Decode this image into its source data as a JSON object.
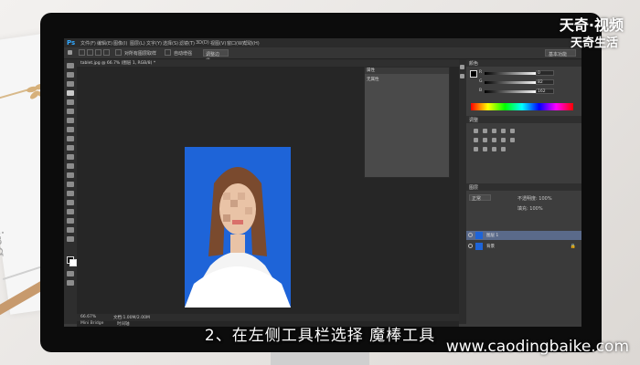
{
  "watermark": {
    "line1": "天奇·视频",
    "line2": "天奇生活"
  },
  "website": "www.caodingbaike.com",
  "subtitle": "2、在左侧工具栏选择 魔棒工具",
  "background_paper_text": "text blurring\nbe blurring\nproduce",
  "photoshop": {
    "logo": "Ps",
    "menu": [
      "文件(F)",
      "编辑(E)",
      "图像(I)",
      "图层(L)",
      "文字(Y)",
      "选择(S)",
      "滤镜(T)",
      "3D(D)",
      "视图(V)",
      "窗口(W)",
      "帮助(H)"
    ],
    "options_bar": {
      "contiguous_label": "对所有图层取样",
      "auto_enhance_label": "自动增强",
      "refine_edge_label": "调整边缘...",
      "workspace": "基本功能"
    },
    "document_tab": "tablet.jpg @ 66.7% (图层 1, RGB/8) *",
    "status": {
      "zoom": "66.67%",
      "doc": "文档:1.00M/2.00M"
    },
    "bottom_tabs": [
      "Mini Bridge",
      "时间轴"
    ],
    "float_panel": {
      "title": "属性",
      "body": "无属性"
    },
    "color_panel": {
      "title": "颜色",
      "channels": [
        "R",
        "G",
        "B"
      ],
      "values": [
        "0",
        "82",
        "162"
      ]
    },
    "adjust_panel": {
      "title": "调整"
    },
    "layers_panel": {
      "title": "图层",
      "blend_mode": "正常",
      "opacity_label": "不透明度: 100%",
      "fill_label": "填充: 100%",
      "layers": [
        {
          "name": "图层 1",
          "active": true
        },
        {
          "name": "背景",
          "active": false
        }
      ]
    }
  }
}
